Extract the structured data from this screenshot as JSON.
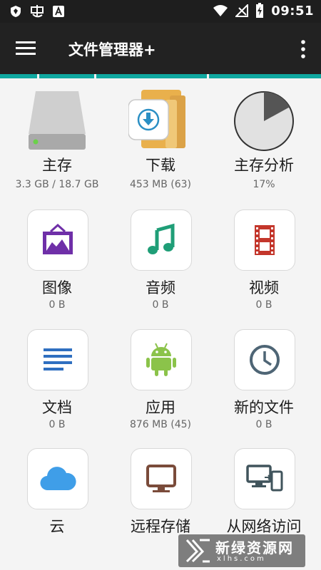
{
  "status_bar": {
    "time": "09:51",
    "left_icons": [
      "shield-icon",
      "game-icon",
      "font-icon"
    ],
    "right_icons": [
      "wifi-icon",
      "no-signal-icon",
      "battery-charging-icon"
    ]
  },
  "app_bar": {
    "title": "文件管理器+",
    "background": "#222222",
    "accent": "#0fa8a0"
  },
  "tiles": [
    {
      "label": "主存",
      "sub": "3.3 GB / 18.7 GB",
      "icon": "hard-drive-icon"
    },
    {
      "label": "下载",
      "sub": "453 MB (63)",
      "icon": "download-folder-icon"
    },
    {
      "label": "主存分析",
      "sub": "17%",
      "icon": "pie-chart-icon",
      "used_fraction": 0.17
    },
    {
      "label": "图像",
      "sub": "0 B",
      "icon": "image-icon"
    },
    {
      "label": "音频",
      "sub": "0 B",
      "icon": "music-note-icon"
    },
    {
      "label": "视频",
      "sub": "0 B",
      "icon": "film-icon"
    },
    {
      "label": "文档",
      "sub": "0 B",
      "icon": "document-lines-icon"
    },
    {
      "label": "应用",
      "sub": "876 MB (45)",
      "icon": "android-icon"
    },
    {
      "label": "新的文件",
      "sub": "0 B",
      "icon": "clock-icon"
    },
    {
      "label": "云",
      "sub": "",
      "icon": "cloud-icon"
    },
    {
      "label": "远程存储",
      "sub": "",
      "icon": "monitor-icon"
    },
    {
      "label": "从网络访问",
      "sub": "",
      "icon": "network-devices-icon"
    }
  ],
  "watermark": {
    "main": "新绿资源网",
    "url": "xlhs.com"
  }
}
